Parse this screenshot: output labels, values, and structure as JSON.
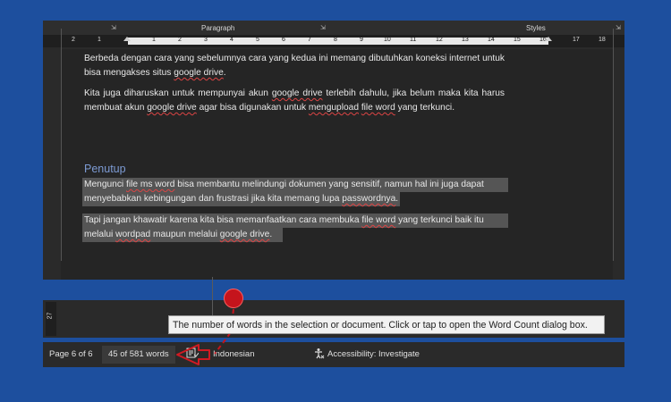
{
  "ribbon": {
    "paragraph_label": "Paragraph",
    "styles_label": "Styles",
    "launcher_glyph": "⇲"
  },
  "ruler": {
    "ticks_left": [
      "2",
      "1"
    ],
    "ticks": [
      "1",
      "2",
      "3",
      "4",
      "5",
      "6",
      "7",
      "8",
      "9",
      "10",
      "11",
      "12",
      "13",
      "14",
      "15",
      "16"
    ],
    "ticks_right": [
      "17",
      "18"
    ],
    "vertical_tick": "27"
  },
  "document": {
    "para1_a": "Berbeda dengan cara yang sebelumnya cara yang kedua ini memang dibutuhkan koneksi internet untuk bisa mengakses situs ",
    "para1_link": "google drive",
    "para1_b": ".",
    "para2_a": "Kita juga diharuskan untuk mempunyai akun ",
    "para2_link1": "google drive",
    "para2_b": " terlebih dahulu, jika belum maka kita harus membuat akun ",
    "para2_link2": "google drive",
    "para2_c": " agar bisa digunakan untuk ",
    "para2_link3": "mengupload",
    "para2_d": " ",
    "para2_link4": "file word",
    "para2_e": " yang terkunci.",
    "heading": "Penutup",
    "sel1_a": "Mengunci ",
    "sel1_link1": "file ms word",
    "sel1_b": " bisa membantu melindungi dokumen yang sensitif, namun hal ini juga dapat",
    "sel2_a": "menyebabkan kebingungan dan frustrasi jika kita memang lupa ",
    "sel2_link": "passwordnya",
    "sel2_b": ".",
    "sel3_a": "Tapi jangan khawatir karena kita bisa memanfaatkan cara membuka ",
    "sel3_link": "file word",
    "sel3_b": " yang terkunci baik itu",
    "sel4_a": "melalui ",
    "sel4_link1": "wordpad",
    "sel4_b": " maupun melalui ",
    "sel4_link2": "google drive",
    "sel4_c": "."
  },
  "status_bar": {
    "page": "Page 6 of 6",
    "word_count": "45 of 581 words",
    "language": "Indonesian",
    "accessibility": "Accessibility: Investigate"
  },
  "tooltip": {
    "text": "The number of words in the selection or document. Click or tap to open the Word Count dialog box."
  },
  "annotation": {
    "color": "#c5141c"
  }
}
